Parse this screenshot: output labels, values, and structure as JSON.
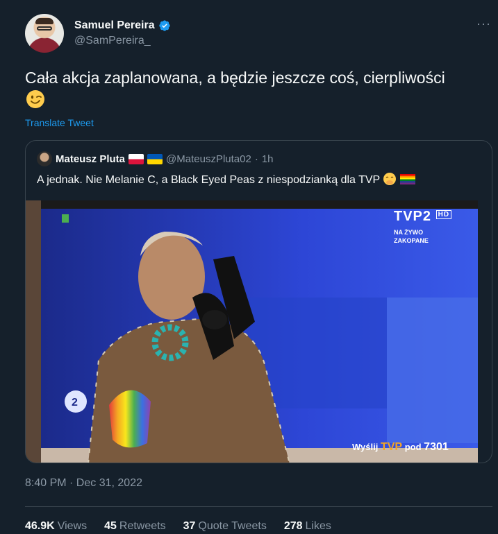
{
  "author": {
    "display_name": "Samuel Pereira",
    "handle": "@SamPereira_"
  },
  "tweet": {
    "text": "Cała akcja zaplanowana, a będzie jeszcze coś, cierpliwości",
    "translate_label": "Translate Tweet",
    "timestamp": "8:40 PM · Dec 31, 2022"
  },
  "quote": {
    "display_name": "Mateusz Pluta",
    "handle": "@MateuszPluta02",
    "separator": "·",
    "time": "1h",
    "text": "A jednak. Nie Melanie C, a Black Eyed Peas z niespodzianką dla TVP",
    "video_overlay": {
      "channel": "TVP2",
      "hd": "HD",
      "live_line1": "NA ŻYWO",
      "live_line2": "ZAKOPANE",
      "sms_prefix": "Wyślij",
      "sms_brand": "TVP",
      "sms_word": "pod",
      "sms_number": "7301"
    }
  },
  "stats": [
    {
      "value": "46.9K",
      "label": "Views"
    },
    {
      "value": "45",
      "label": "Retweets"
    },
    {
      "value": "37",
      "label": "Quote Tweets"
    },
    {
      "value": "278",
      "label": "Likes"
    }
  ],
  "icons": {
    "verified": "verified-badge-icon",
    "more": "more-options-icon",
    "wink": "winking-face-emoji",
    "hand_over_mouth": "face-with-hand-over-mouth-emoji",
    "rainbow": "rainbow-flag-emoji"
  },
  "colors": {
    "background": "#15202b",
    "accent": "#1d9bf0",
    "secondary_text": "#8b98a5",
    "border": "#38444d"
  }
}
